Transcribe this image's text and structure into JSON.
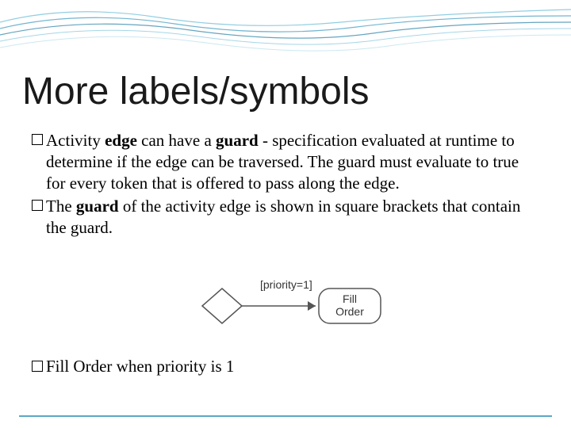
{
  "title": "More labels/symbols",
  "bullets": [
    {
      "prefix": "Activity ",
      "bold1": "edge",
      "mid": " can have a ",
      "bold2": "guard",
      "rest": " - specification evaluated at runtime to determine if the edge can be traversed. The guard must evaluate to true for every token that is offered to pass along the edge."
    },
    {
      "prefix": "The ",
      "bold1": "guard",
      "mid": " of the activity edge is shown in square brackets that contain the guard.",
      "bold2": "",
      "rest": ""
    }
  ],
  "diagram": {
    "guard_label": "[priority=1]",
    "action_line1": "Fill",
    "action_line2": "Order"
  },
  "caption": "Fill Order when priority is 1",
  "chart_data": {
    "type": "diagram",
    "kind": "uml-activity-edge-guard",
    "elements": {
      "decision_node": {
        "shape": "diamond"
      },
      "edge": {
        "from": "decision_node",
        "to": "action",
        "guard": "[priority=1]"
      },
      "action": {
        "label": "Fill Order",
        "shape": "rounded-rect"
      }
    },
    "caption": "Fill Order when priority is 1"
  }
}
